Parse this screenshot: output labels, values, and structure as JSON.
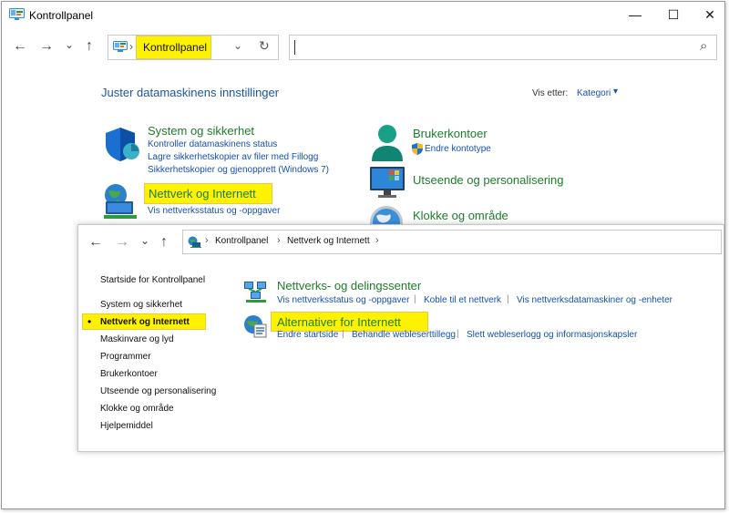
{
  "window": {
    "title": "Kontrollpanel",
    "controls": {
      "minimize": "—",
      "maximize": "☐",
      "close": "✕"
    }
  },
  "nav": {
    "back": "←",
    "forward": "→",
    "history": "⌄",
    "up": "↑",
    "refresh": "↻",
    "search_glyph": "⌕"
  },
  "address": {
    "crumb": "Kontrollpanel",
    "chevron": "›",
    "dropdown": "⌄"
  },
  "page": {
    "heading": "Juster datamaskinens innstillinger",
    "view_by_label": "Vis etter:",
    "view_by_value": "Kategori",
    "view_by_arrow": "▾"
  },
  "categories": {
    "system": {
      "title": "System og sikkerhet",
      "links": [
        "Kontroller datamaskinens status",
        "Lagre sikkerhetskopier av filer med Fillogg",
        "Sikkerhetskopier og gjenopprett (Windows 7)"
      ]
    },
    "network": {
      "title": "Nettverk og Internett",
      "links": [
        "Vis nettverksstatus og -oppgaver"
      ]
    },
    "users": {
      "title": "Brukerkontoer",
      "links": [
        "Endre kontotype"
      ]
    },
    "appearance": {
      "title": "Utseende og personalisering"
    },
    "clock": {
      "title": "Klokke og område"
    }
  },
  "inner": {
    "nav": {
      "back": "←",
      "forward": "→",
      "history": "⌄",
      "up": "↑"
    },
    "breadcrumb": [
      "Kontrollpanel",
      "Nettverk og Internett"
    ],
    "chevron": "›",
    "sidebar": {
      "home": "Startside for Kontrollpanel",
      "bullet": "•",
      "items": [
        "System og sikkerhet",
        "Nettverk og Internett",
        "Maskinvare og lyd",
        "Programmer",
        "Brukerkontoer",
        "Utseende og personalisering",
        "Klokke og område",
        "Hjelpemiddel"
      ]
    },
    "sections": {
      "network_center": {
        "title": "Nettverks- og delingssenter",
        "links": [
          "Vis nettverksstatus og -oppgaver",
          "Koble til et nettverk",
          "Vis nettverksdatamaskiner og -enheter"
        ]
      },
      "internet_options": {
        "title": "Alternativer for Internett",
        "links": [
          "Endre startside",
          "Behandle webleserttillegg",
          "Slett webleserlogg og informasjonskapsler"
        ]
      }
    }
  },
  "colors": {
    "heading": "#1a56a5",
    "category_title": "#1d7d2a",
    "link": "#1450b4",
    "highlight": "#fff200"
  }
}
